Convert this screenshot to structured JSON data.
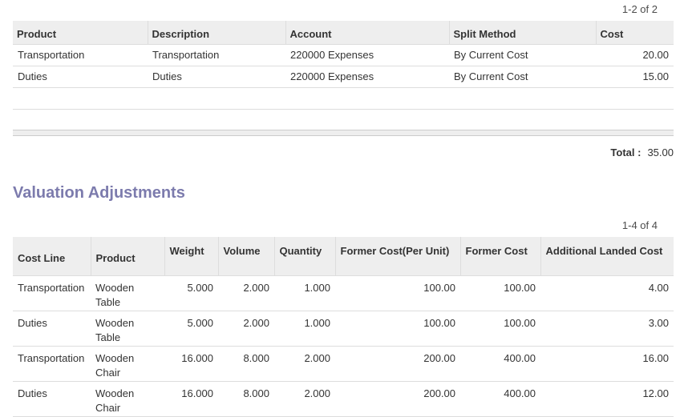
{
  "cost_lines": {
    "pager": "1-2 of 2",
    "headers": {
      "product": "Product",
      "description": "Description",
      "account": "Account",
      "split_method": "Split Method",
      "cost": "Cost"
    },
    "rows": [
      {
        "product": "Transportation",
        "description": "Transportation",
        "account": "220000 Expenses",
        "split_method": "By Current Cost",
        "cost": "20.00"
      },
      {
        "product": "Duties",
        "description": "Duties",
        "account": "220000 Expenses",
        "split_method": "By Current Cost",
        "cost": "15.00"
      }
    ],
    "total_label": "Total :",
    "total_value": "35.00"
  },
  "valuation": {
    "title": "Valuation Adjustments",
    "pager": "1-4 of 4",
    "headers": {
      "cost_line": "Cost Line",
      "product": "Product",
      "weight": "Weight",
      "volume": "Volume",
      "quantity": "Quantity",
      "former_cost_unit": "Former Cost(Per Unit)",
      "former_cost": "Former Cost",
      "additional_landed_cost": "Additional Landed Cost"
    },
    "rows": [
      {
        "cost_line": "Transportation",
        "product": "Wooden Table",
        "weight": "5.000",
        "volume": "2.000",
        "quantity": "1.000",
        "former_cost_unit": "100.00",
        "former_cost": "100.00",
        "additional": "4.00"
      },
      {
        "cost_line": "Duties",
        "product": "Wooden Table",
        "weight": "5.000",
        "volume": "2.000",
        "quantity": "1.000",
        "former_cost_unit": "100.00",
        "former_cost": "100.00",
        "additional": "3.00"
      },
      {
        "cost_line": "Transportation",
        "product": "Wooden Chair",
        "weight": "16.000",
        "volume": "8.000",
        "quantity": "2.000",
        "former_cost_unit": "200.00",
        "former_cost": "400.00",
        "additional": "16.00"
      },
      {
        "cost_line": "Duties",
        "product": "Wooden Chair",
        "weight": "16.000",
        "volume": "8.000",
        "quantity": "2.000",
        "former_cost_unit": "200.00",
        "former_cost": "400.00",
        "additional": "12.00"
      }
    ]
  }
}
